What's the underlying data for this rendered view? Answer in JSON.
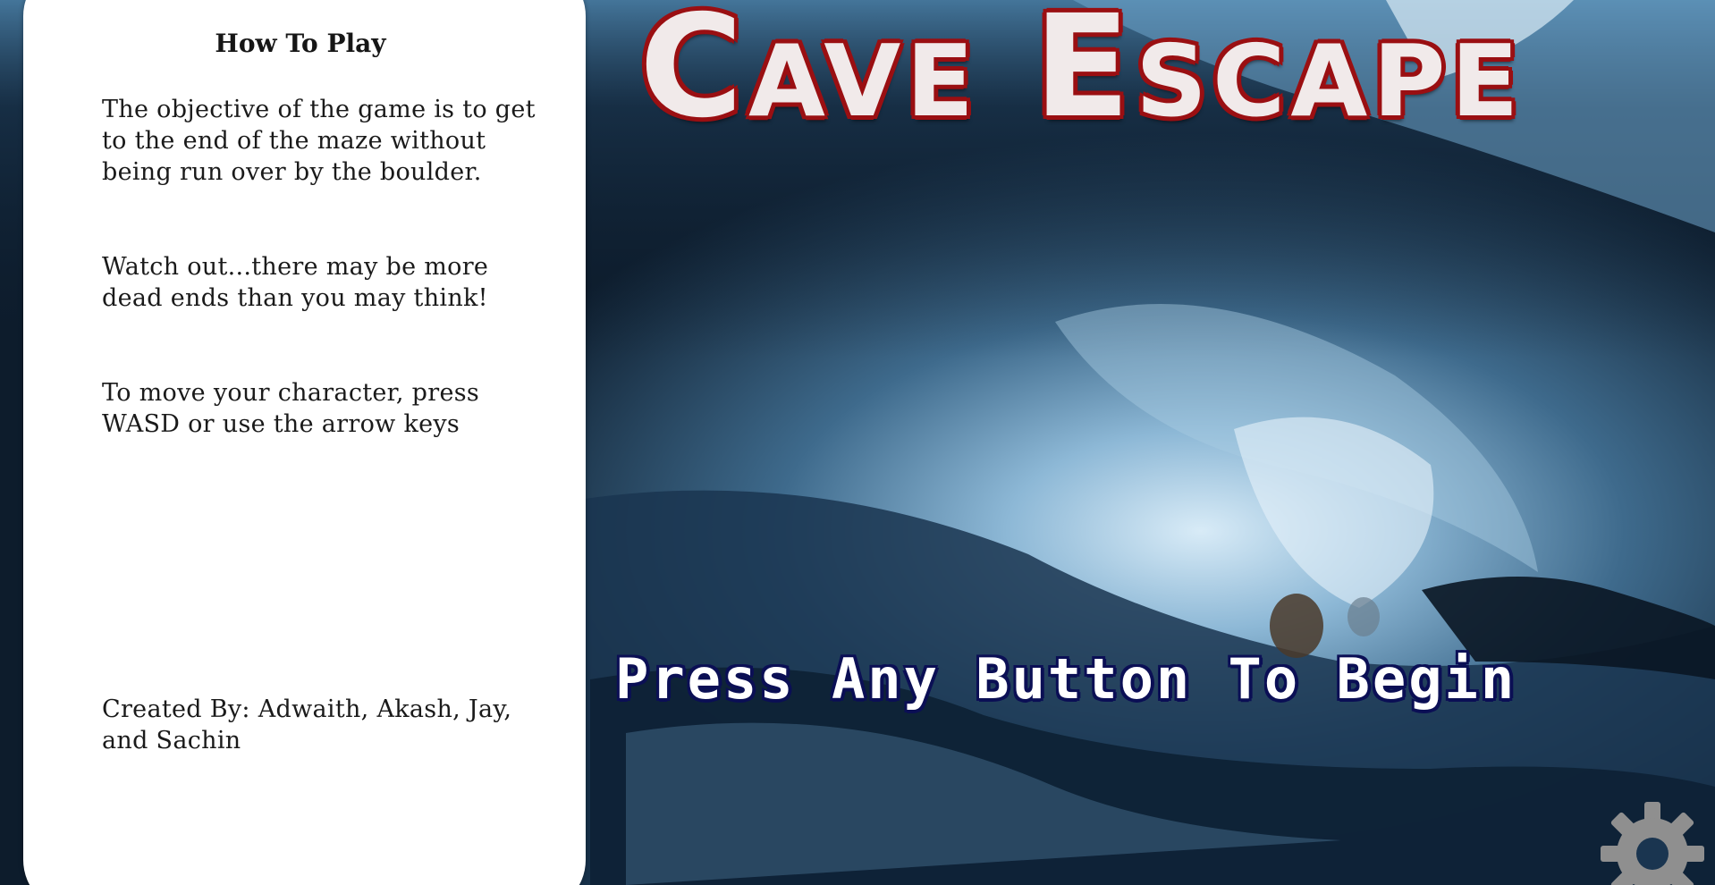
{
  "game": {
    "title": "Cave Escape",
    "prompt": "Press Any Button To Begin"
  },
  "how_to_play": {
    "heading": "How To Play",
    "objective": "The objective of the game is to get to the end of the maze without being run over by the boulder.",
    "warning": "Watch out...there may be more dead ends than you may think!",
    "controls": "To move your character, press WASD or use the arrow keys",
    "credits": "Created By: Adwaith, Akash, Jay, and Sachin"
  },
  "settings": {
    "icon": "gear-icon"
  },
  "colors": {
    "title_fill": "#f1eaea",
    "title_outline": "#9a0f12",
    "prompt_fill": "#ffffff",
    "prompt_outline": "#0b0f55",
    "panel": "#ffffff",
    "cave_dark": "#0d1c2c",
    "cave_light": "#cfe4f2",
    "gear": "#8f8f8f"
  }
}
